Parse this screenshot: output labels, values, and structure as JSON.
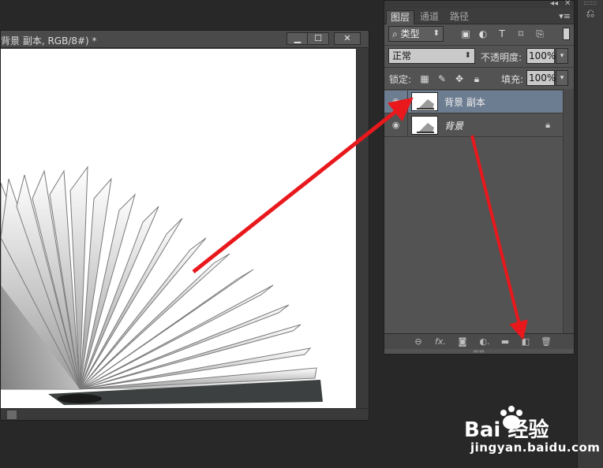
{
  "document": {
    "title": "背景 副本, RGB/8#) *",
    "controls": {
      "minimize": "▁",
      "maximize": "☐",
      "close": "✕"
    }
  },
  "panel": {
    "header_controls": {
      "collapse": "◂◂",
      "close": "✕"
    },
    "tabs": [
      {
        "label": "图层",
        "active": true
      },
      {
        "label": "通道",
        "active": false
      },
      {
        "label": "路径",
        "active": false
      }
    ],
    "filter": {
      "icon": "search-icon",
      "value": "类型"
    },
    "blend_mode": "正常",
    "opacity": {
      "label": "不透明度:",
      "value": "100%"
    },
    "lock": {
      "label": "锁定:"
    },
    "fill": {
      "label": "填充:",
      "value": "100%"
    },
    "layers": [
      {
        "name": "背景 副本",
        "selected": true,
        "italic": false,
        "locked": false
      },
      {
        "name": "背景",
        "selected": false,
        "italic": true,
        "locked": true
      }
    ],
    "footer_icons": [
      "link-icon",
      "fx-icon",
      "mask-icon",
      "adjustment-icon",
      "folder-icon",
      "new-layer-icon",
      "trash-icon"
    ],
    "fx_label": "fx."
  },
  "colors": {
    "arrow": "#e8181c",
    "selected_layer": "#6d7d91"
  },
  "watermark": {
    "logo": "Bai 经验",
    "url": "jingyan.baidu.com"
  }
}
